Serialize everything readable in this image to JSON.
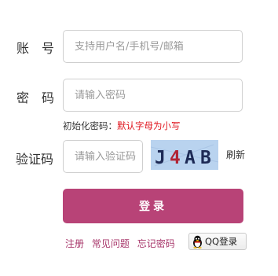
{
  "form": {
    "account_label": "账　号",
    "account_placeholder": "支持用户名/手机号/邮箱",
    "password_label": "密　码",
    "password_placeholder": "请输入密码",
    "hint_prefix": "初始化密码：",
    "hint_value": "默认字母为小写",
    "captcha_label": "验证码",
    "captcha_placeholder": "请输入验证码",
    "captcha_text": "J4AB",
    "refresh_label": "刷新",
    "login_label": "登录"
  },
  "links": {
    "register": "注册",
    "faq": "常见问题",
    "forgot": "忘记密码",
    "qq_login": "QQ登录"
  },
  "colors": {
    "accent": "#b84377",
    "hint_red": "#e0161f",
    "link": "#a7366a",
    "captcha_bg": "#b9d3ef"
  }
}
